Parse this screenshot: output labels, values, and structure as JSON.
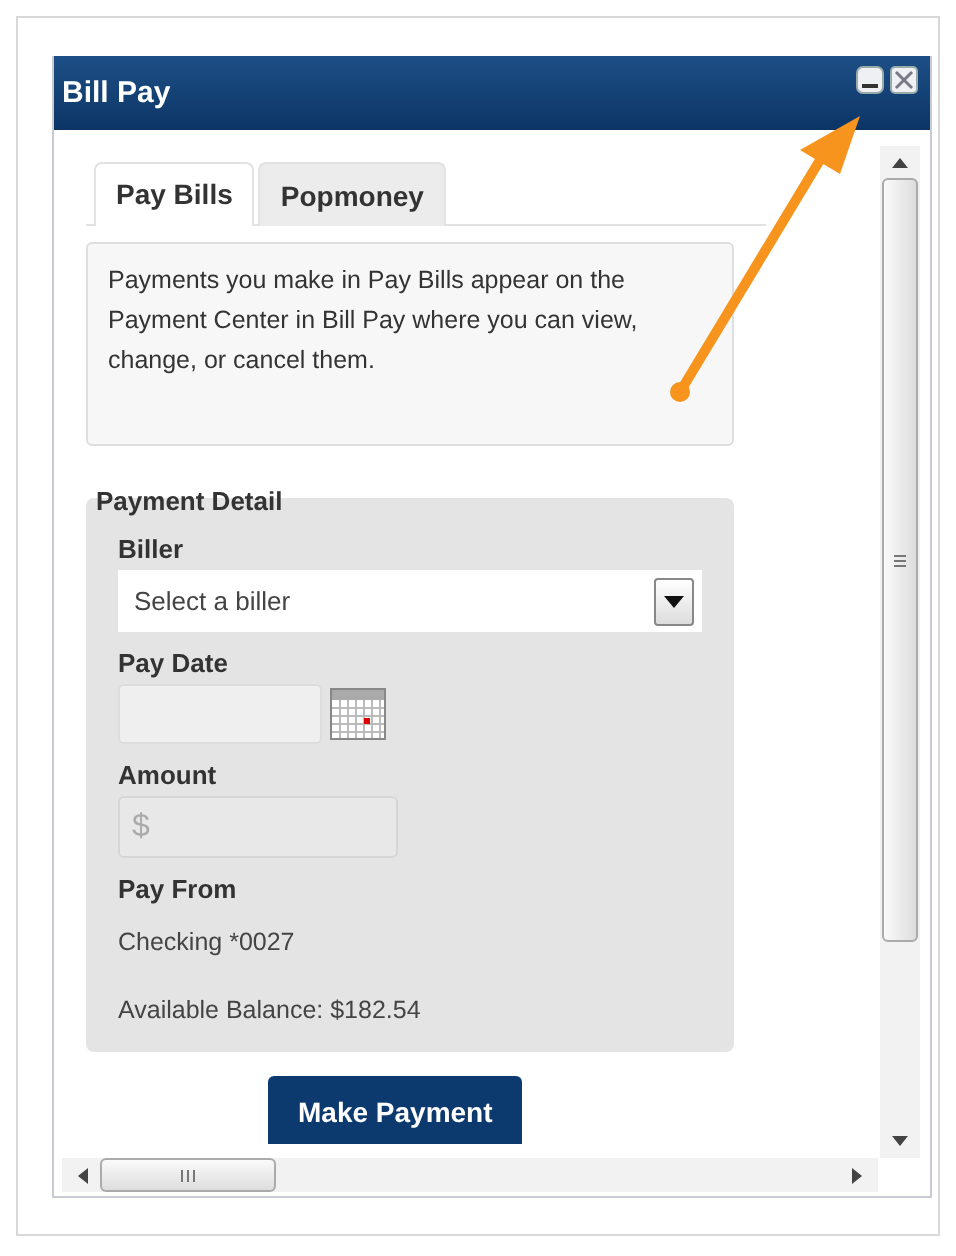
{
  "window": {
    "title": "Bill Pay"
  },
  "tabs": [
    {
      "label": "Pay Bills",
      "selected": true
    },
    {
      "label": "Popmoney",
      "selected": false
    }
  ],
  "notice": "Payments you make in Pay Bills appear on the Payment Center in Bill Pay where you can view, change, or cancel them.",
  "payment_detail": {
    "title": "Payment Detail",
    "fields": [
      {
        "kind": "select",
        "label": "Biller",
        "value": "Select a biller"
      },
      {
        "kind": "date",
        "label": "Pay Date"
      },
      {
        "kind": "amount",
        "label": "Amount",
        "placeholder": "$"
      },
      {
        "kind": "info",
        "label": "Pay From",
        "lines": [
          "Checking *0027",
          "Available Balance: $182.54"
        ]
      }
    ]
  },
  "primary_button": "Make Payment"
}
